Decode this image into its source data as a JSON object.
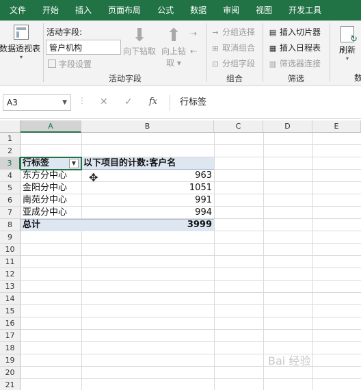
{
  "menu": {
    "tabs": [
      "文件",
      "开始",
      "插入",
      "页面布局",
      "公式",
      "数据",
      "审阅",
      "视图",
      "开发工具"
    ]
  },
  "ribbon": {
    "pivot_table_label": "数据透视表",
    "active_field": {
      "label": "活动字段:",
      "value": "管户机构",
      "field_settings": "字段设置",
      "drill_down": "向下钻取",
      "drill_up": "向上钻",
      "drill_up_suffix": "取 ▾",
      "group_label": "活动字段"
    },
    "group": {
      "group_selection": "分组选择",
      "ungroup": "取消组合",
      "group_field": "分组字段",
      "group_label": "组合"
    },
    "filter": {
      "insert_slicer": "插入切片器",
      "insert_timeline": "插入日程表",
      "filter_connections": "筛选器连接",
      "group_label": "筛选"
    },
    "refresh_label": "刷新",
    "data_label_partial": "数"
  },
  "formula_bar": {
    "name_box": "A3",
    "value": "行标签"
  },
  "grid": {
    "columns": [
      "A",
      "B",
      "C",
      "D",
      "E"
    ],
    "rows": [
      "1",
      "2",
      "3",
      "4",
      "5",
      "6",
      "7",
      "8",
      "9",
      "10",
      "11",
      "12",
      "13",
      "14",
      "15",
      "16",
      "17",
      "18",
      "19",
      "20",
      "21"
    ],
    "pivot": {
      "header_label": "行标签",
      "header_value": "以下项目的计数:客户名",
      "items": [
        {
          "label": "东方分中心",
          "value": "963"
        },
        {
          "label": "金阳分中心",
          "value": "1051"
        },
        {
          "label": "南苑分中心",
          "value": "991"
        },
        {
          "label": "亚成分中心",
          "value": "994"
        }
      ],
      "total_label": "总计",
      "total_value": "3999"
    }
  },
  "watermark": "Bai 经验",
  "colors": {
    "excel_green": "#217346",
    "pivot_band": "#dde6f1"
  }
}
